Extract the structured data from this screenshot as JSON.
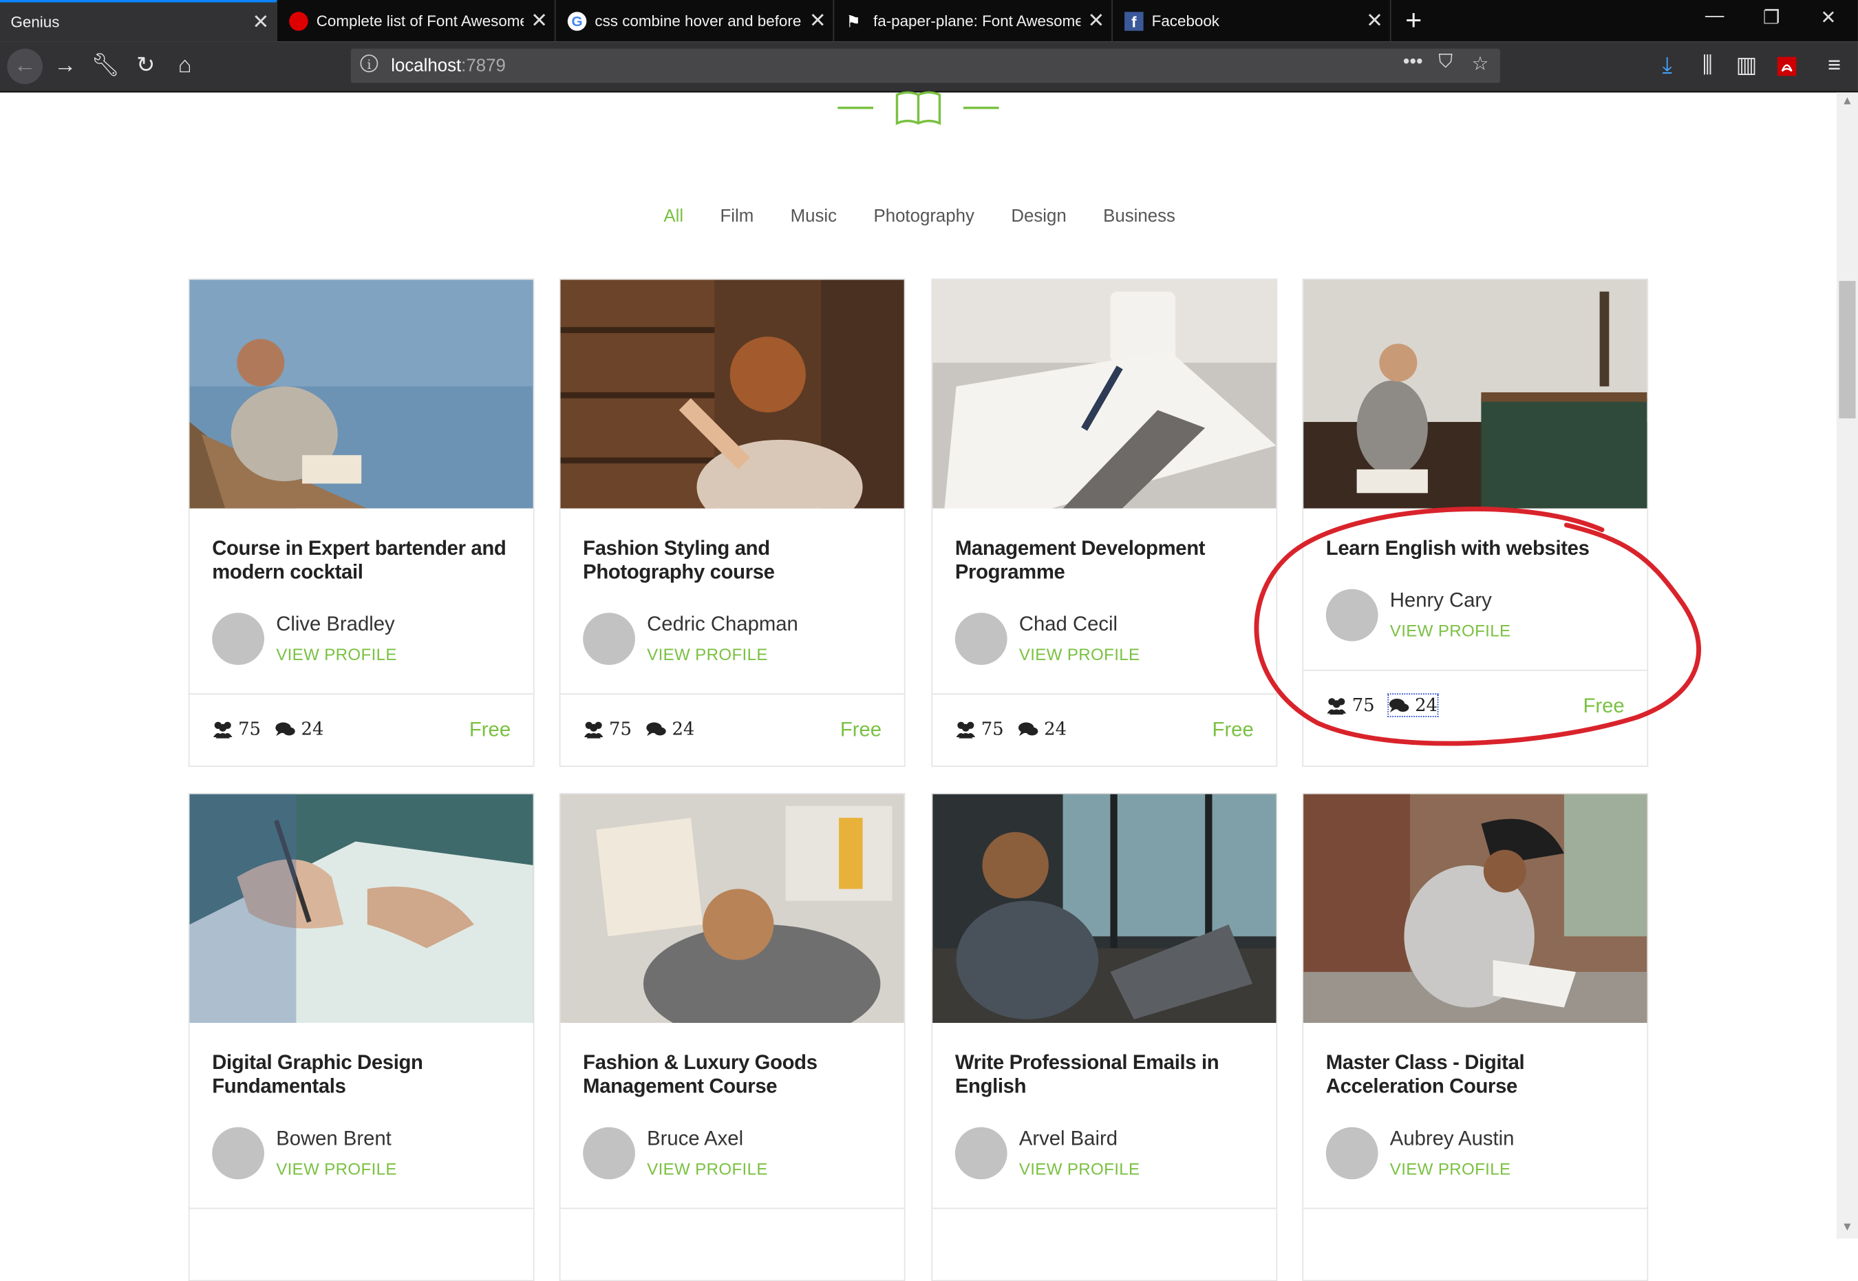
{
  "browser": {
    "tabs": [
      {
        "title": "Genius",
        "active": true
      },
      {
        "title": "Complete list of Font Awesome",
        "active": false
      },
      {
        "title": "css combine hover and before",
        "active": false
      },
      {
        "title": "fa-paper-plane: Font Awesome",
        "active": false
      },
      {
        "title": "Facebook",
        "active": false
      }
    ],
    "url_host": "localhost",
    "url_port": ":7879"
  },
  "filters": [
    "All",
    "Film",
    "Music",
    "Photography",
    "Design",
    "Business"
  ],
  "courses": [
    {
      "title": "Course in Expert bartender and modern cocktail",
      "author": "Clive Bradley",
      "link": "VIEW PROFILE",
      "students": "75",
      "comments": "24",
      "price": "Free"
    },
    {
      "title": "Fashion Styling and Photography course",
      "author": "Cedric Chapman",
      "link": "VIEW PROFILE",
      "students": "75",
      "comments": "24",
      "price": "Free"
    },
    {
      "title": "Management Development Programme",
      "author": "Chad Cecil",
      "link": "VIEW PROFILE",
      "students": "75",
      "comments": "24",
      "price": "Free"
    },
    {
      "title": "Learn English with websites",
      "author": "Henry Cary",
      "link": "VIEW PROFILE",
      "students": "75",
      "comments": "24",
      "price": "Free"
    },
    {
      "title": "Digital Graphic Design Fundamentals",
      "author": "Bowen Brent",
      "link": "VIEW PROFILE"
    },
    {
      "title": "Fashion & Luxury Goods Management Course",
      "author": "Bruce Axel",
      "link": "VIEW PROFILE"
    },
    {
      "title": "Write Professional Emails in English",
      "author": "Arvel Baird",
      "link": "VIEW PROFILE"
    },
    {
      "title": "Master Class - Digital Acceleration Course",
      "author": "Aubrey Austin",
      "link": "VIEW PROFILE"
    }
  ],
  "colors": {
    "accent": "#7ac142",
    "annotation": "#d9232b"
  }
}
